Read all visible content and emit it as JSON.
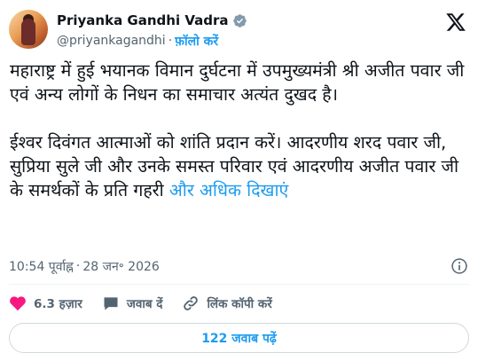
{
  "author": {
    "name": "Priyanka Gandhi Vadra",
    "handle": "@priyankagandhi",
    "separator": "·",
    "follow_label": "फ़ॉलो करें"
  },
  "tweet": {
    "paragraph1": "महाराष्ट्र में हुई भयानक विमान दुर्घटना में उपमुख्यमंत्री श्री अजीत पवार जी एवं अन्य लोगों के निधन का समाचार अत्यंत दुखद है।",
    "paragraph2": "ईश्वर दिवंगत आत्माओं को शांति प्रदान करें। आदरणीय शरद पवार जी, सुप्रिया सुले जी और उनके समस्त परिवार एवं आदरणीय अजीत पवार जी के समर्थकों के प्रति गहरी",
    "show_more": "और अधिक दिखाएं"
  },
  "meta": {
    "time": "10:54 पूर्वाह्न",
    "separator": "·",
    "date": "28 जन॰ 2026"
  },
  "actions": {
    "likes": "6.3 हज़ार",
    "reply": "जवाब दें",
    "copy_link": "लिंक कॉपी करें"
  },
  "replies_button": "122 जवाब पढ़ें",
  "colors": {
    "accent": "#1d9bf0",
    "like": "#f91880",
    "secondary_text": "#536471",
    "border": "#cfd9de"
  },
  "icons": {
    "verified": "verified-badge-icon",
    "x_logo": "x-logo-icon",
    "info": "info-icon",
    "like": "heart-icon",
    "reply": "speech-bubble-icon",
    "copy_link": "link-icon"
  }
}
